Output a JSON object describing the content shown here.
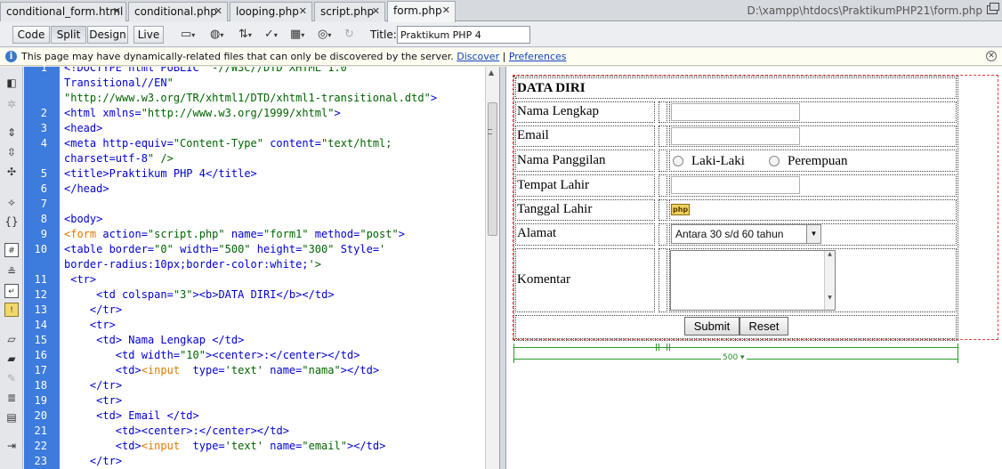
{
  "tabs": [
    {
      "label": "conditional_form.html"
    },
    {
      "label": "conditional.php"
    },
    {
      "label": "looping.php"
    },
    {
      "label": "script.php"
    },
    {
      "label": "form.php"
    }
  ],
  "file_path": "D:\\xampp\\htdocs\\PraktikumPHP21\\form.php",
  "toolbar": {
    "code_label": "Code",
    "split_label": "Split",
    "design_label": "Design",
    "live_label": "Live",
    "title_label": "Title:",
    "title_value": "Praktikum PHP 4"
  },
  "infobar": {
    "message": "This page may have dynamically-related files that can only be discovered by the server.",
    "discover_label": "Discover",
    "separator": "|",
    "preferences_label": "Preferences"
  },
  "code_lines": [
    {
      "n": "1",
      "text": "<!DOCTYPE html PUBLIC \"-//W3C//DTD XHTML 1.0"
    },
    {
      "n": "",
      "text": "Transitional//EN\""
    },
    {
      "n": "",
      "text": "\"http://www.w3.org/TR/xhtml1/DTD/xhtml1-transitional.dtd\">"
    },
    {
      "n": "2",
      "text": "<html xmlns=\"http://www.w3.org/1999/xhtml\">"
    },
    {
      "n": "3",
      "text": "<head>"
    },
    {
      "n": "4",
      "text": "<meta http-equiv=\"Content-Type\" content=\"text/html;"
    },
    {
      "n": "",
      "text": "charset=utf-8\" />"
    },
    {
      "n": "5",
      "text": "<title>Praktikum PHP 4</title>"
    },
    {
      "n": "6",
      "text": "</head>"
    },
    {
      "n": "7",
      "text": ""
    },
    {
      "n": "8",
      "text": "<body>"
    },
    {
      "n": "9",
      "text": "<form action=\"script.php\" name=\"form1\" method=\"post\">"
    },
    {
      "n": "10",
      "text": "<table border=\"0\" width=\"500\" height=\"300\" Style='"
    },
    {
      "n": "",
      "text": "border-radius:10px;border-color:white;'>"
    },
    {
      "n": "11",
      "text": " <tr>"
    },
    {
      "n": "12",
      "text": "     <td colspan=\"3\"><b>DATA DIRI</b></td>"
    },
    {
      "n": "13",
      "text": "    </tr>"
    },
    {
      "n": "14",
      "text": "    <tr>"
    },
    {
      "n": "15",
      "text": "     <td> Nama Lengkap </td>"
    },
    {
      "n": "16",
      "text": "        <td width=\"10\"><center>:</center></td>"
    },
    {
      "n": "17",
      "text": "        <td><input  type='text' name=\"nama\"></td>"
    },
    {
      "n": "18",
      "text": "    </tr>"
    },
    {
      "n": "19",
      "text": "     <tr>"
    },
    {
      "n": "20",
      "text": "     <td> Email </td>"
    },
    {
      "n": "21",
      "text": "        <td><center>:</center></td>"
    },
    {
      "n": "22",
      "text": "        <td><input  type='text' name=\"email\"></td>"
    },
    {
      "n": "23",
      "text": "    </tr>"
    }
  ],
  "design": {
    "heading": "DATA DIRI",
    "labels": {
      "nama": "Nama Lengkap",
      "email": "Email",
      "panggilan": "Nama Panggilan",
      "tempat": "Tempat Lahir",
      "tanggal": "Tanggal Lahir",
      "alamat": "Alamat",
      "komentar": "Komentar"
    },
    "radio_options": [
      "Laki-Laki",
      "Perempuan"
    ],
    "php_badge": "php",
    "select_value": "Antara 30 s/d 60 tahun",
    "submit_label": "Submit",
    "reset_label": "Reset",
    "table_width_label": "500"
  },
  "colors": {
    "gutter": "#3d7bdc",
    "tag": "#0000d0",
    "form_tag": "#e07800",
    "string": "#006400",
    "width_ruler": "#2b9a2b",
    "form_outline": "#e04040"
  }
}
